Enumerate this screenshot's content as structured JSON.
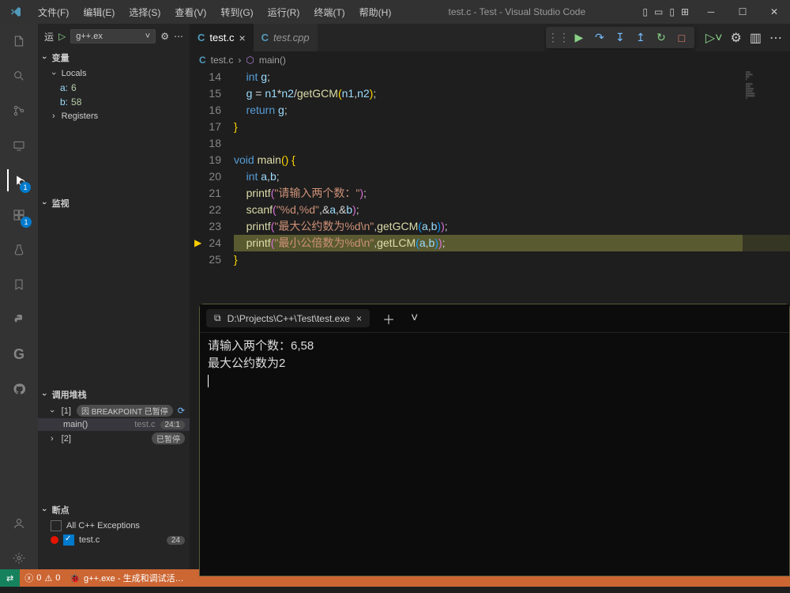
{
  "title": "test.c - Test - Visual Studio Code",
  "menu": [
    "文件(F)",
    "编辑(E)",
    "选择(S)",
    "查看(V)",
    "转到(G)",
    "运行(R)",
    "终端(T)",
    "帮助(H)"
  ],
  "sidebar": {
    "run_label": "运",
    "config": "g++.ex",
    "sections": {
      "vars": "变量",
      "locals": "Locals",
      "registers": "Registers",
      "watch": "监视",
      "callstack": "调用堆栈",
      "breakpoints": "断点"
    },
    "local_vars": [
      {
        "name": "a:",
        "value": "6"
      },
      {
        "name": "b:",
        "value": "58"
      }
    ],
    "callstack": {
      "thread1": "[1]",
      "thread1_state": "因 BREAKPOINT 已暂停",
      "frame": "main()",
      "frame_file": "test.c",
      "frame_loc": "24:1",
      "thread2": "[2]",
      "thread2_state": "已暂停"
    },
    "breakpoints": {
      "all_cpp": "All C++ Exceptions",
      "file": "test.c",
      "file_line": "24"
    }
  },
  "tabs": [
    {
      "icon": "C",
      "label": "test.c",
      "active": true,
      "close": true
    },
    {
      "icon": "C",
      "label": "test.cpp",
      "active": false,
      "close": false
    }
  ],
  "breadcrumb": {
    "file": "test.c",
    "symbol": "main()"
  },
  "code": {
    "start": 14,
    "current": 24,
    "lines": [
      {
        "n": 14,
        "html": "    <span class='ty'>int</span> <span class='id'>g</span>;"
      },
      {
        "n": 15,
        "html": "    <span class='id'>g</span> <span class='op'>=</span> <span class='id'>n1</span><span class='op'>*</span><span class='id'>n2</span><span class='op'>/</span><span class='fn'>getGCM</span><span class='br'>(</span><span class='id'>n1</span>,<span class='id'>n2</span><span class='br'>)</span>;"
      },
      {
        "n": 16,
        "html": "    <span class='kw'>return</span> <span class='id'>g</span>;"
      },
      {
        "n": 17,
        "html": "<span class='br'>}</span>"
      },
      {
        "n": 18,
        "html": ""
      },
      {
        "n": 19,
        "html": "<span class='ty'>void</span> <span class='fn'>main</span><span class='br'>(</span><span class='br'>)</span> <span class='br'>{</span>"
      },
      {
        "n": 20,
        "html": "    <span class='ty'>int</span> <span class='id'>a</span>,<span class='id'>b</span>;"
      },
      {
        "n": 21,
        "html": "    <span class='fn'>printf</span><span class='br2'>(</span><span class='str'>\"请输入两个数：\"</span><span class='br2'>)</span>;"
      },
      {
        "n": 22,
        "html": "    <span class='fn'>scanf</span><span class='br2'>(</span><span class='str'>\"%d,%d\"</span>,<span class='op'>&</span><span class='id'>a</span>,<span class='op'>&</span><span class='id'>b</span><span class='br2'>)</span>;"
      },
      {
        "n": 23,
        "html": "    <span class='fn'>printf</span><span class='br2'>(</span><span class='str'>\"最大公约数为%d\\n\"</span>,<span class='fn'>getGCM</span><span class='br3'>(</span><span class='id'>a</span>,<span class='id'>b</span><span class='br3'>)</span><span class='br2'>)</span>;"
      },
      {
        "n": 24,
        "hl": true,
        "html": "    <span class='fn'>printf</span><span class='br2'>(</span><span class='str'>\"最小公倍数为%d\\n\"</span>,<span class='fn'>getLCM</span><span class='br3'>(</span><span class='id'>a</span>,<span class='id'>b</span><span class='br3'>)</span><span class='br2'>)</span>;"
      },
      {
        "n": 25,
        "html": "<span class='br'>}</span>"
      }
    ]
  },
  "terminal": {
    "tab": "D:\\Projects\\C++\\Test\\test.exe",
    "lines": [
      "请输入两个数：6,58",
      "最大公约数为2"
    ]
  },
  "status": {
    "errors": "0",
    "warnings": "0",
    "config": "g++.exe - 生成和调试活…"
  }
}
